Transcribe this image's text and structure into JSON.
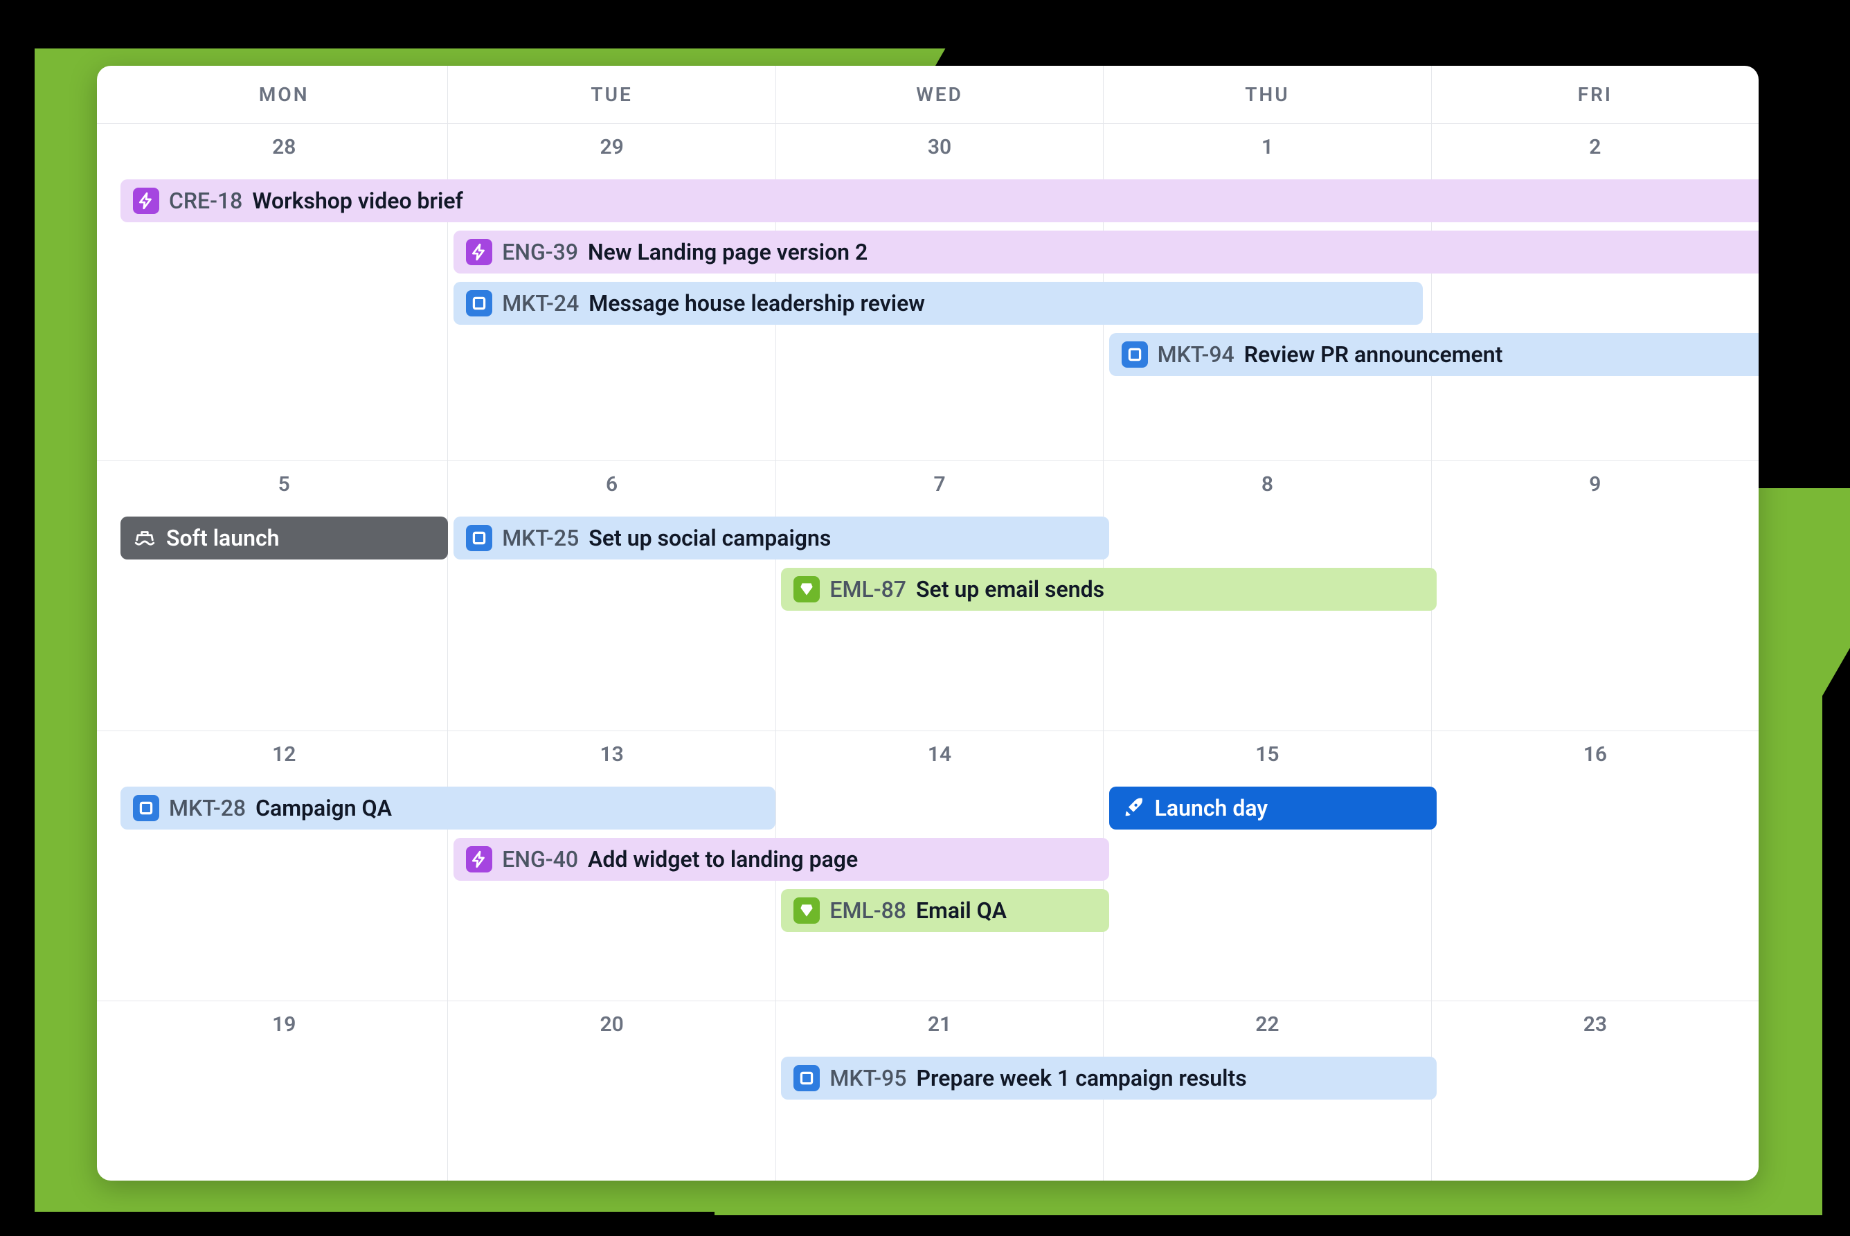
{
  "headers": [
    "MON",
    "TUE",
    "WED",
    "THU",
    "FRI"
  ],
  "weeks": [
    {
      "days": [
        "28",
        "29",
        "30",
        "1",
        "2"
      ]
    },
    {
      "days": [
        "5",
        "6",
        "7",
        "8",
        "9"
      ]
    },
    {
      "days": [
        "12",
        "13",
        "14",
        "15",
        "16"
      ]
    },
    {
      "days": [
        "19",
        "20",
        "21",
        "22",
        "23"
      ]
    }
  ],
  "events": {
    "w0": {
      "cre18": {
        "code": "CRE-18",
        "title": "Workshop video brief"
      },
      "eng39": {
        "code": "ENG-39",
        "title": "New Landing page version 2"
      },
      "mkt24": {
        "code": "MKT-24",
        "title": "Message house leadership review"
      },
      "mkt94": {
        "code": "MKT-94",
        "title": "Review PR announcement"
      }
    },
    "w1": {
      "soft": {
        "title": "Soft launch"
      },
      "mkt25": {
        "code": "MKT-25",
        "title": "Set up social campaigns"
      },
      "eml87": {
        "code": "EML-87",
        "title": "Set up email sends"
      }
    },
    "w2": {
      "mkt28": {
        "code": "MKT-28",
        "title": "Campaign QA"
      },
      "launch": {
        "title": "Launch day"
      },
      "eng40": {
        "code": "ENG-40",
        "title": "Add widget to landing page"
      },
      "eml88": {
        "code": "EML-88",
        "title": "Email QA"
      }
    },
    "w3": {
      "mkt95": {
        "code": "MKT-95",
        "title": "Prepare week 1 campaign results"
      }
    }
  }
}
